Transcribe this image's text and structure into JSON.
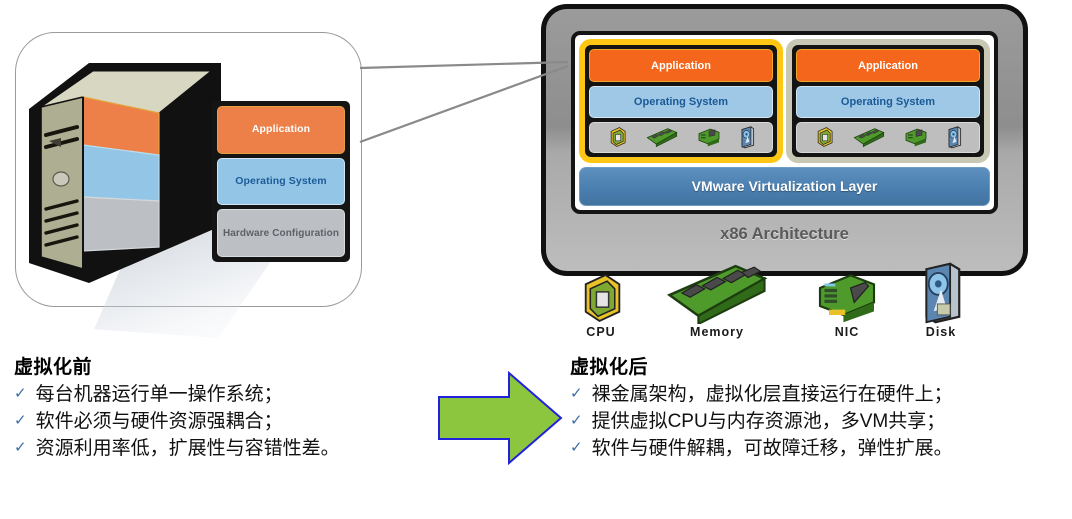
{
  "left_diagram": {
    "name": "traditional-physical-server",
    "stack": [
      {
        "label": "Application",
        "color": "#ED8048"
      },
      {
        "label": "Operating System",
        "color": "#93C6E6"
      },
      {
        "label": "Hardware Configuration",
        "color": "#BCC0C4"
      }
    ]
  },
  "right_diagram": {
    "name": "virtualized-server",
    "vms": [
      {
        "highlighted": true,
        "highlight_color": "#FFC713",
        "app_label": "Application",
        "os_label": "Operating System",
        "hardware_icons": [
          "cpu-icon",
          "memory-icon",
          "nic-icon",
          "disk-icon"
        ]
      },
      {
        "highlighted": false,
        "highlight_color": "#C8C8B4",
        "app_label": "Application",
        "os_label": "Operating System",
        "hardware_icons": [
          "cpu-icon",
          "memory-icon",
          "nic-icon",
          "disk-icon"
        ]
      }
    ],
    "virtualization_layer": "VMware Virtualization Layer",
    "architecture_label": "x86 Architecture",
    "hardware": [
      {
        "label": "CPU",
        "icon": "cpu-icon"
      },
      {
        "label": "Memory",
        "icon": "memory-icon"
      },
      {
        "label": "NIC",
        "icon": "nic-icon"
      },
      {
        "label": "Disk",
        "icon": "disk-icon"
      }
    ]
  },
  "before": {
    "title": "虚拟化前",
    "bullet": "✓",
    "items": [
      "每台机器运行单一操作系统；",
      "软件必须与硬件资源强耦合；",
      "资源利用率低，扩展性与容错性差。"
    ]
  },
  "after": {
    "title": "虚拟化后",
    "bullet": "✓",
    "items": [
      "裸金属架构，虚拟化层直接运行在硬件上；",
      "提供虚拟CPU与内存资源池，多VM共享；",
      "软件与硬件解耦，可故障迁移，弹性扩展。"
    ]
  },
  "arrow": {
    "name": "transition-arrow",
    "fill": "#8CC63F",
    "stroke": "#2222DD"
  },
  "colors": {
    "application": "#F4661B",
    "operating_system": "#9EC8E6",
    "hardware": "#BEBEBE",
    "vmware_layer": "#4A7FB0",
    "highlight": "#FFC713",
    "check": "#3B6EA8"
  }
}
